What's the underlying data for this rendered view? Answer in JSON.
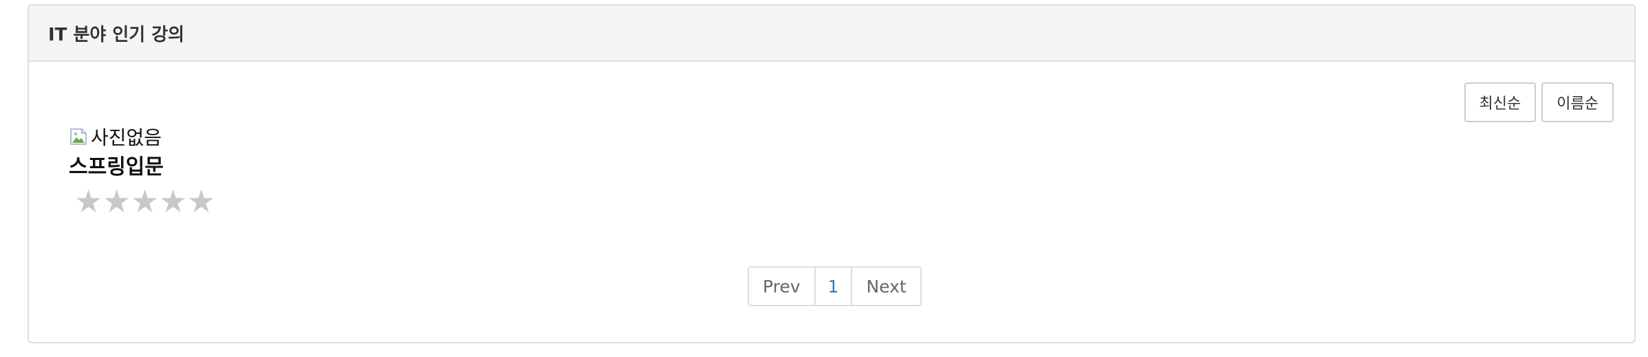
{
  "panel": {
    "title": "IT 분야 인기 강의"
  },
  "sort": {
    "latest_label": "최신순",
    "name_label": "이름순"
  },
  "courses": [
    {
      "image_alt": "사진없음",
      "title": "스프링입문",
      "rating": 0,
      "max_rating": 5
    }
  ],
  "pagination": {
    "prev_label": "Prev",
    "current_page": "1",
    "next_label": "Next"
  },
  "colors": {
    "heading_bg": "#f5f5f5",
    "border": "#dddddd",
    "star_empty": "#c8c8c8",
    "active_page": "#337ab7"
  },
  "icons": {
    "image_placeholder": "broken-image-icon",
    "rating": "star-icon"
  }
}
